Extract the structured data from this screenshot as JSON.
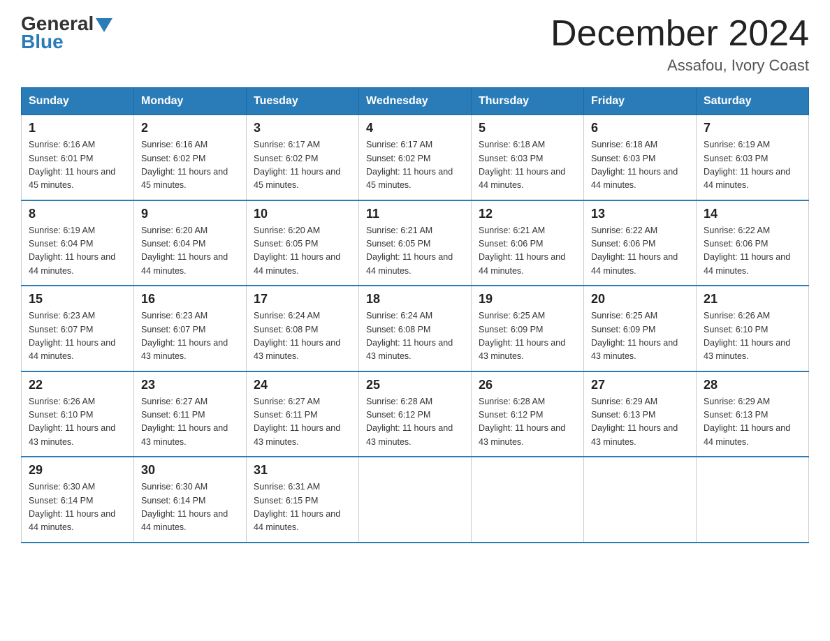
{
  "logo": {
    "text_general": "General",
    "text_blue": "Blue"
  },
  "title": "December 2024",
  "subtitle": "Assafou, Ivory Coast",
  "days_of_week": [
    "Sunday",
    "Monday",
    "Tuesday",
    "Wednesday",
    "Thursday",
    "Friday",
    "Saturday"
  ],
  "weeks": [
    [
      {
        "day": "1",
        "sunrise": "6:16 AM",
        "sunset": "6:01 PM",
        "daylight": "11 hours and 45 minutes."
      },
      {
        "day": "2",
        "sunrise": "6:16 AM",
        "sunset": "6:02 PM",
        "daylight": "11 hours and 45 minutes."
      },
      {
        "day": "3",
        "sunrise": "6:17 AM",
        "sunset": "6:02 PM",
        "daylight": "11 hours and 45 minutes."
      },
      {
        "day": "4",
        "sunrise": "6:17 AM",
        "sunset": "6:02 PM",
        "daylight": "11 hours and 45 minutes."
      },
      {
        "day": "5",
        "sunrise": "6:18 AM",
        "sunset": "6:03 PM",
        "daylight": "11 hours and 44 minutes."
      },
      {
        "day": "6",
        "sunrise": "6:18 AM",
        "sunset": "6:03 PM",
        "daylight": "11 hours and 44 minutes."
      },
      {
        "day": "7",
        "sunrise": "6:19 AM",
        "sunset": "6:03 PM",
        "daylight": "11 hours and 44 minutes."
      }
    ],
    [
      {
        "day": "8",
        "sunrise": "6:19 AM",
        "sunset": "6:04 PM",
        "daylight": "11 hours and 44 minutes."
      },
      {
        "day": "9",
        "sunrise": "6:20 AM",
        "sunset": "6:04 PM",
        "daylight": "11 hours and 44 minutes."
      },
      {
        "day": "10",
        "sunrise": "6:20 AM",
        "sunset": "6:05 PM",
        "daylight": "11 hours and 44 minutes."
      },
      {
        "day": "11",
        "sunrise": "6:21 AM",
        "sunset": "6:05 PM",
        "daylight": "11 hours and 44 minutes."
      },
      {
        "day": "12",
        "sunrise": "6:21 AM",
        "sunset": "6:06 PM",
        "daylight": "11 hours and 44 minutes."
      },
      {
        "day": "13",
        "sunrise": "6:22 AM",
        "sunset": "6:06 PM",
        "daylight": "11 hours and 44 minutes."
      },
      {
        "day": "14",
        "sunrise": "6:22 AM",
        "sunset": "6:06 PM",
        "daylight": "11 hours and 44 minutes."
      }
    ],
    [
      {
        "day": "15",
        "sunrise": "6:23 AM",
        "sunset": "6:07 PM",
        "daylight": "11 hours and 44 minutes."
      },
      {
        "day": "16",
        "sunrise": "6:23 AM",
        "sunset": "6:07 PM",
        "daylight": "11 hours and 43 minutes."
      },
      {
        "day": "17",
        "sunrise": "6:24 AM",
        "sunset": "6:08 PM",
        "daylight": "11 hours and 43 minutes."
      },
      {
        "day": "18",
        "sunrise": "6:24 AM",
        "sunset": "6:08 PM",
        "daylight": "11 hours and 43 minutes."
      },
      {
        "day": "19",
        "sunrise": "6:25 AM",
        "sunset": "6:09 PM",
        "daylight": "11 hours and 43 minutes."
      },
      {
        "day": "20",
        "sunrise": "6:25 AM",
        "sunset": "6:09 PM",
        "daylight": "11 hours and 43 minutes."
      },
      {
        "day": "21",
        "sunrise": "6:26 AM",
        "sunset": "6:10 PM",
        "daylight": "11 hours and 43 minutes."
      }
    ],
    [
      {
        "day": "22",
        "sunrise": "6:26 AM",
        "sunset": "6:10 PM",
        "daylight": "11 hours and 43 minutes."
      },
      {
        "day": "23",
        "sunrise": "6:27 AM",
        "sunset": "6:11 PM",
        "daylight": "11 hours and 43 minutes."
      },
      {
        "day": "24",
        "sunrise": "6:27 AM",
        "sunset": "6:11 PM",
        "daylight": "11 hours and 43 minutes."
      },
      {
        "day": "25",
        "sunrise": "6:28 AM",
        "sunset": "6:12 PM",
        "daylight": "11 hours and 43 minutes."
      },
      {
        "day": "26",
        "sunrise": "6:28 AM",
        "sunset": "6:12 PM",
        "daylight": "11 hours and 43 minutes."
      },
      {
        "day": "27",
        "sunrise": "6:29 AM",
        "sunset": "6:13 PM",
        "daylight": "11 hours and 43 minutes."
      },
      {
        "day": "28",
        "sunrise": "6:29 AM",
        "sunset": "6:13 PM",
        "daylight": "11 hours and 44 minutes."
      }
    ],
    [
      {
        "day": "29",
        "sunrise": "6:30 AM",
        "sunset": "6:14 PM",
        "daylight": "11 hours and 44 minutes."
      },
      {
        "day": "30",
        "sunrise": "6:30 AM",
        "sunset": "6:14 PM",
        "daylight": "11 hours and 44 minutes."
      },
      {
        "day": "31",
        "sunrise": "6:31 AM",
        "sunset": "6:15 PM",
        "daylight": "11 hours and 44 minutes."
      },
      null,
      null,
      null,
      null
    ]
  ]
}
